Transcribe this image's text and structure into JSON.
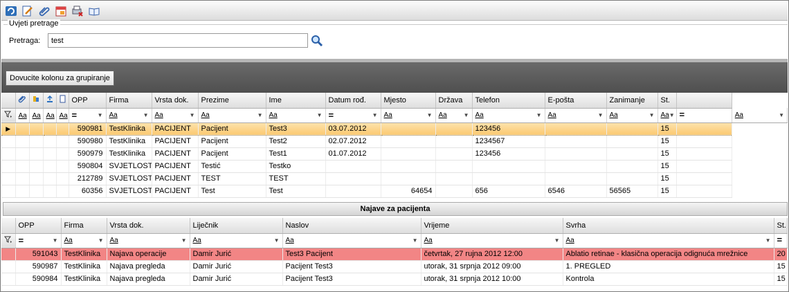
{
  "toolbar": {
    "icons": [
      "refresh-icon",
      "edit-note-icon",
      "attachment-icon",
      "calendar-icon",
      "print-delete-icon",
      "book-icon"
    ]
  },
  "search": {
    "legend": "Uvjeti pretrage",
    "label": "Pretraga:",
    "value": "test"
  },
  "grouping": {
    "button_label": "Dovucite kolonu za grupiranje"
  },
  "patients": {
    "columns": [
      "OPP",
      "Firma",
      "Vrsta dok.",
      "Prezime",
      "Ime",
      "Datum rođ.",
      "Mjesto",
      "Država",
      "Telefon",
      "E-pošta",
      "Zanimanje",
      "St."
    ],
    "filters": [
      "Aa",
      "Aa",
      "Aa",
      "Aa",
      "=",
      "Aa",
      "Aa",
      "Aa",
      "Aa",
      "=",
      "Aa",
      "Aa",
      "Aa",
      "Aa",
      "Aa",
      "Aa",
      "=",
      "Aa"
    ],
    "rows": [
      {
        "opp": "590981",
        "firma": "TestKlinika",
        "vrsta": "PACIJENT",
        "prezime": "Pacijent",
        "ime": "Test3",
        "datum": "03.07.2012",
        "mjesto": "",
        "drzava": "",
        "telefon": "123456",
        "eposta": "",
        "zanimanje": "",
        "st": "15"
      },
      {
        "opp": "590980",
        "firma": "TestKlinika",
        "vrsta": "PACIJENT",
        "prezime": "Pacijent",
        "ime": "Test2",
        "datum": "02.07.2012",
        "mjesto": "",
        "drzava": "",
        "telefon": "1234567",
        "eposta": "",
        "zanimanje": "",
        "st": "15"
      },
      {
        "opp": "590979",
        "firma": "TestKlinika",
        "vrsta": "PACIJENT",
        "prezime": "Pacijent",
        "ime": "Test1",
        "datum": "01.07.2012",
        "mjesto": "",
        "drzava": "",
        "telefon": "123456",
        "eposta": "",
        "zanimanje": "",
        "st": "15"
      },
      {
        "opp": "590804",
        "firma": "SVJETLOST",
        "vrsta": "PACIJENT",
        "prezime": "Testić",
        "ime": "Testko",
        "datum": "",
        "mjesto": "",
        "drzava": "",
        "telefon": "",
        "eposta": "",
        "zanimanje": "",
        "st": "15"
      },
      {
        "opp": "212789",
        "firma": "SVJETLOST",
        "vrsta": "PACIJENT",
        "prezime": "TEST",
        "ime": "TEST",
        "datum": "",
        "mjesto": "",
        "drzava": "",
        "telefon": "",
        "eposta": "",
        "zanimanje": "",
        "st": "15"
      },
      {
        "opp": "60356",
        "firma": "SVJETLOST",
        "vrsta": "PACIJENT",
        "prezime": "Test",
        "ime": "Test",
        "datum": "",
        "mjesto": "64654",
        "drzava": "",
        "telefon": "656",
        "eposta": "6546",
        "zanimanje": "56565",
        "st": "15"
      }
    ]
  },
  "appointments": {
    "title": "Najave za pacijenta",
    "columns": [
      "OPP",
      "Firma",
      "Vrsta dok.",
      "Liječnik",
      "Naslov",
      "Vrijeme",
      "Svrha",
      "St."
    ],
    "filters": [
      "=",
      "Aa",
      "Aa",
      "Aa",
      "Aa",
      "Aa",
      "Aa",
      "="
    ],
    "rows": [
      {
        "opp": "591043",
        "firma": "TestKlinika",
        "vrsta": "Najava operacije",
        "lijecnik": "Damir Jurić",
        "naslov": "Test3 Pacijent",
        "vrijeme": "četvrtak, 27 rujna 2012 12:00",
        "svrha": "Ablatio retinae - klasična operacija odignuća mrežnice",
        "st": "20"
      },
      {
        "opp": "590987",
        "firma": "TestKlinika",
        "vrsta": "Najava pregleda",
        "lijecnik": "Damir Jurić",
        "naslov": "Pacijent Test3",
        "vrijeme": "utorak, 31 srpnja 2012 09:00",
        "svrha": "1. PREGLED",
        "st": "15"
      },
      {
        "opp": "590984",
        "firma": "TestKlinika",
        "vrsta": "Najava pregleda",
        "lijecnik": "Damir Jurić",
        "naslov": "Pacijent Test3",
        "vrijeme": "utorak, 31 srpnja 2012 10:00",
        "svrha": "Kontrola",
        "st": "15"
      }
    ]
  }
}
